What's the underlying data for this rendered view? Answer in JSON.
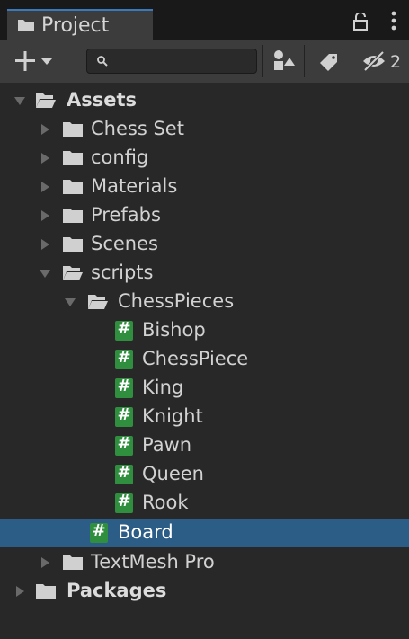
{
  "tab": {
    "title": "Project",
    "icon": "folder-icon"
  },
  "window_controls": {
    "lock_icon": "lock-icon",
    "menu_icon": "kebab-menu-icon"
  },
  "toolbar": {
    "create_icon": "plus-dropdown-icon",
    "search_placeholder": "",
    "search_value": "",
    "filter_by_type_icon": "shapes-icon",
    "filter_by_label_icon": "tag-icon",
    "hidden_packages_icon": "eye-slash-icon",
    "hidden_packages_count": "2"
  },
  "tree": {
    "assets": {
      "label": "Assets"
    },
    "chess_set": {
      "label": "Chess Set"
    },
    "config": {
      "label": "config"
    },
    "materials": {
      "label": "Materials"
    },
    "prefabs": {
      "label": "Prefabs"
    },
    "scenes": {
      "label": "Scenes"
    },
    "scripts": {
      "label": "scripts"
    },
    "chess_pieces": {
      "label": "ChessPieces"
    },
    "bishop": {
      "label": "Bishop"
    },
    "chess_piece": {
      "label": "ChessPiece"
    },
    "king": {
      "label": "King"
    },
    "knight": {
      "label": "Knight"
    },
    "pawn": {
      "label": "Pawn"
    },
    "queen": {
      "label": "Queen"
    },
    "rook": {
      "label": "Rook"
    },
    "board": {
      "label": "Board",
      "selected": true
    },
    "textmesh_pro": {
      "label": "TextMesh Pro"
    },
    "packages": {
      "label": "Packages"
    }
  },
  "colors": {
    "selection": "#2c5d87",
    "script_icon": "#2f8f3e",
    "tab_accent": "#3a79bb"
  }
}
